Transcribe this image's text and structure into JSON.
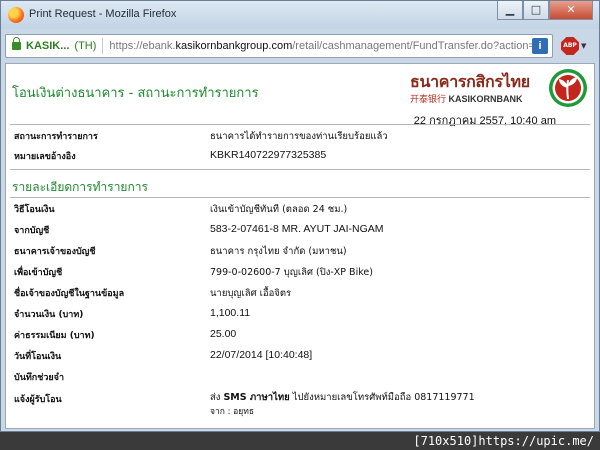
{
  "window": {
    "title": "Print Request - Mozilla Firefox",
    "buttons": {
      "minimize": "▁",
      "maximize": "□",
      "close": "✕"
    }
  },
  "urlbar": {
    "identity_label": "KASIK...",
    "identity_country": "(TH)",
    "url_prefix": "https://ebank.",
    "url_host": "kasikornbankgroup.com",
    "url_path": "/retail/cashmanagement/FundTransfer.do?action=print&ac",
    "info_icon": "i",
    "addon_label": "ABP"
  },
  "page": {
    "heading": "โอนเงินต่างธนาคาร - สถานะการทำรายการ",
    "logo": {
      "thai": "ธนาคารกสิกรไทย",
      "cjk": "开泰银行",
      "english": "KASIKORNBANK"
    },
    "datetime": "22 กรกฎาคม 2557, 10:40 am",
    "summary": [
      {
        "label": "สถานะการทำรายการ",
        "value": "ธนาคารได้ทำรายการของท่านเรียบร้อยแล้ว"
      },
      {
        "label": "หมายเลขอ้างอิง",
        "value": "KBKR140722977325385"
      }
    ],
    "details_heading": "รายละเอียดการทำรายการ",
    "details": [
      {
        "label": "วิธีโอนเงิน",
        "value": "เงินเข้าบัญชีทันที (ตลอด 24 ชม.)"
      },
      {
        "label": "จากบัญชี",
        "value": "583-2-07461-8 MR. AYUT JAI-NGAM"
      },
      {
        "label": "ธนาคารเจ้าของบัญชี",
        "value": "ธนาคาร กรุงไทย จำกัด (มหาชน)"
      },
      {
        "label": "เพื่อเข้าบัญชี",
        "value": "799-0-02600-7 บุญเลิศ (ปิง-XP Bike)"
      },
      {
        "label": "ชื่อเจ้าของบัญชีในฐานข้อมูล",
        "value": "นายบุญเลิศ เอื้อจิตร"
      },
      {
        "label": "จำนวนเงิน (บาท)",
        "value": "1,100.11"
      },
      {
        "label": "ค่าธรรมเนียม (บาท)",
        "value": "25.00"
      },
      {
        "label": "วันที่โอนเงิน",
        "value": "22/07/2014 [10:40:48]"
      },
      {
        "label": "บันทึกช่วยจำ",
        "value": ""
      }
    ],
    "notify": {
      "label": "แจ้งผู้รับโอน",
      "prefix": "ส่ง ",
      "bold": "SMS ภาษาไทย",
      "rest": " ไปยังหมายเลขโทรศัพท์มือถือ 0817119771",
      "from": "จาก : อยุทธ"
    }
  },
  "watermark": "[710x510]https://upic.me/",
  "colors": {
    "heading_green": "#1d8a2e",
    "logo_green": "#1f9a3a",
    "logo_red": "#c3261c"
  }
}
